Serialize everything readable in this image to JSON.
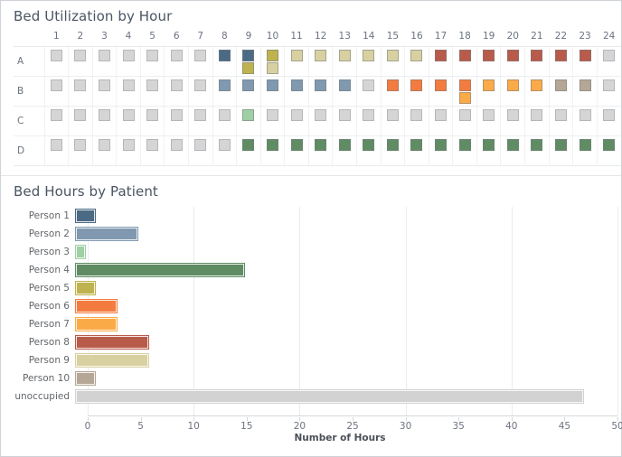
{
  "panels": {
    "utilization": {
      "title": "Bed Utilization by Hour",
      "hours": [
        "1",
        "2",
        "3",
        "4",
        "5",
        "6",
        "7",
        "8",
        "9",
        "10",
        "11",
        "12",
        "13",
        "14",
        "15",
        "16",
        "17",
        "18",
        "19",
        "20",
        "21",
        "22",
        "23",
        "24"
      ],
      "beds": [
        "A",
        "B",
        "C",
        "D"
      ]
    },
    "hours": {
      "title": "Bed Hours by Patient"
    }
  },
  "colors": {
    "empty": "#d5d5d5",
    "person1": "#4c6a84",
    "person2": "#8099b0",
    "person3": "#9fcfa5",
    "person4": "#5f8c63",
    "person5": "#bfb34f",
    "person6": "#f47b3f",
    "person7": "#fbaa48",
    "person8": "#b85b4a",
    "person9": "#d8d0a0",
    "person10": "#b5a795",
    "unoccupied": "#d2d2d2"
  },
  "chart_data": [
    {
      "type": "heatmap",
      "title": "Bed Utilization by Hour",
      "xlabel": "",
      "ylabel": "",
      "x": [
        "1",
        "2",
        "3",
        "4",
        "5",
        "6",
        "7",
        "8",
        "9",
        "10",
        "11",
        "12",
        "13",
        "14",
        "15",
        "16",
        "17",
        "18",
        "19",
        "20",
        "21",
        "22",
        "23",
        "24"
      ],
      "y": [
        "A",
        "B",
        "C",
        "D"
      ],
      "legend": "none",
      "grid": true,
      "cells": {
        "A": [
          [
            "empty"
          ],
          [
            "empty"
          ],
          [
            "empty"
          ],
          [
            "empty"
          ],
          [
            "empty"
          ],
          [
            "empty"
          ],
          [
            "empty"
          ],
          [
            "person1"
          ],
          [
            "person1",
            "person5"
          ],
          [
            "person5",
            "person9"
          ],
          [
            "person9"
          ],
          [
            "person9"
          ],
          [
            "person9"
          ],
          [
            "person9"
          ],
          [
            "person9"
          ],
          [
            "person9"
          ],
          [
            "person8"
          ],
          [
            "person8"
          ],
          [
            "person8"
          ],
          [
            "person8"
          ],
          [
            "person8"
          ],
          [
            "person8"
          ],
          [
            "person8"
          ],
          [
            "empty"
          ]
        ],
        "B": [
          [
            "empty"
          ],
          [
            "empty"
          ],
          [
            "empty"
          ],
          [
            "empty"
          ],
          [
            "empty"
          ],
          [
            "empty"
          ],
          [
            "empty"
          ],
          [
            "person2"
          ],
          [
            "person2"
          ],
          [
            "person2"
          ],
          [
            "person2"
          ],
          [
            "person2"
          ],
          [
            "person2"
          ],
          [
            "empty"
          ],
          [
            "person6"
          ],
          [
            "person6"
          ],
          [
            "person6"
          ],
          [
            "person6",
            "person7"
          ],
          [
            "person7"
          ],
          [
            "person7"
          ],
          [
            "person7"
          ],
          [
            "person10"
          ],
          [
            "person10"
          ],
          [
            "empty"
          ]
        ],
        "C": [
          [
            "empty"
          ],
          [
            "empty"
          ],
          [
            "empty"
          ],
          [
            "empty"
          ],
          [
            "empty"
          ],
          [
            "empty"
          ],
          [
            "empty"
          ],
          [
            "empty"
          ],
          [
            "person3"
          ],
          [
            "empty"
          ],
          [
            "empty"
          ],
          [
            "empty"
          ],
          [
            "empty"
          ],
          [
            "empty"
          ],
          [
            "empty"
          ],
          [
            "empty"
          ],
          [
            "empty"
          ],
          [
            "empty"
          ],
          [
            "empty"
          ],
          [
            "empty"
          ],
          [
            "empty"
          ],
          [
            "empty"
          ],
          [
            "empty"
          ],
          [
            "empty"
          ]
        ],
        "D": [
          [
            "empty"
          ],
          [
            "empty"
          ],
          [
            "empty"
          ],
          [
            "empty"
          ],
          [
            "empty"
          ],
          [
            "empty"
          ],
          [
            "empty"
          ],
          [
            "empty"
          ],
          [
            "person4"
          ],
          [
            "person4"
          ],
          [
            "person4"
          ],
          [
            "person4"
          ],
          [
            "person4"
          ],
          [
            "person4"
          ],
          [
            "person4"
          ],
          [
            "person4"
          ],
          [
            "person4"
          ],
          [
            "person4"
          ],
          [
            "person4"
          ],
          [
            "person4"
          ],
          [
            "person4"
          ],
          [
            "person4"
          ],
          [
            "person4"
          ],
          [
            "person4"
          ]
        ]
      }
    },
    {
      "type": "bar",
      "orientation": "horizontal",
      "title": "Bed Hours by Patient",
      "xlabel": "Number of Hours",
      "ylabel": "",
      "categories": [
        "Person 1",
        "Person 2",
        "Person 3",
        "Person 4",
        "Person 5",
        "Person 6",
        "Person 7",
        "Person 8",
        "Person 9",
        "Person 10",
        "unoccupied"
      ],
      "values": [
        2,
        6,
        1,
        16,
        2,
        4,
        4,
        7,
        7,
        2,
        48
      ],
      "bar_colors": [
        "#4c6a84",
        "#8099b0",
        "#9fcfa5",
        "#5f8c63",
        "#bfb34f",
        "#f47b3f",
        "#fbaa48",
        "#b85b4a",
        "#d8d0a0",
        "#b5a795",
        "#d2d2d2"
      ],
      "xlim": [
        0,
        50
      ],
      "xticks": [
        0,
        5,
        10,
        15,
        20,
        25,
        30,
        35,
        40,
        45,
        50
      ],
      "xticklabels": [
        "0",
        "5",
        "10",
        "15",
        "20",
        "25",
        "30",
        "35",
        "40",
        "45",
        "50"
      ],
      "grid": true,
      "legend": "none"
    }
  ]
}
